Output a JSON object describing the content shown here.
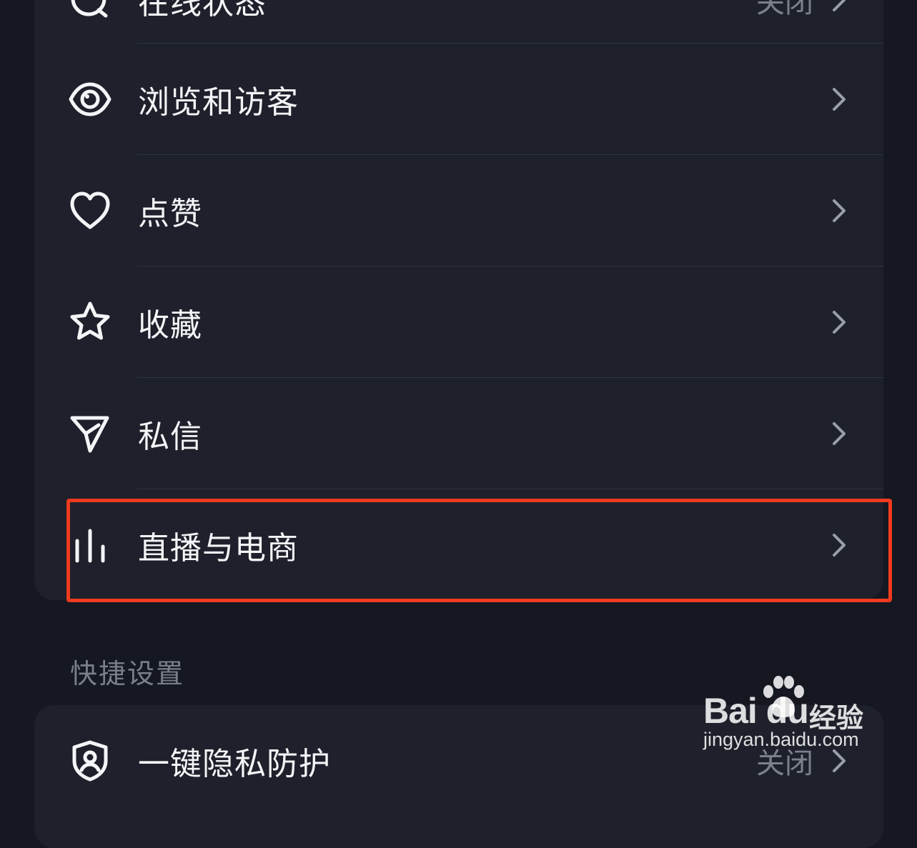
{
  "top_card": {
    "rows": [
      {
        "label": "在线状态",
        "value": "关闭",
        "icon": "online-status-icon"
      },
      {
        "label": "浏览和访客",
        "icon": "eye-icon"
      },
      {
        "label": "点赞",
        "icon": "heart-icon"
      },
      {
        "label": "收藏",
        "icon": "star-icon"
      },
      {
        "label": "私信",
        "icon": "send-icon"
      },
      {
        "label": "直播与电商",
        "icon": "bar-chart-icon"
      }
    ]
  },
  "quick_settings": {
    "title": "快捷设置",
    "rows": [
      {
        "label": "一键隐私防护",
        "value": "关闭",
        "icon": "shield-user-icon"
      }
    ]
  },
  "annotation": {
    "highlight_color": "#f03a1f"
  },
  "watermark": {
    "brand": "Bai du",
    "suffix": "经验",
    "url": "jingyan.baidu.com"
  },
  "colors": {
    "background": "#151821",
    "card": "#1e212b",
    "text_primary": "#f4f5f7",
    "text_secondary": "#7c808a"
  }
}
